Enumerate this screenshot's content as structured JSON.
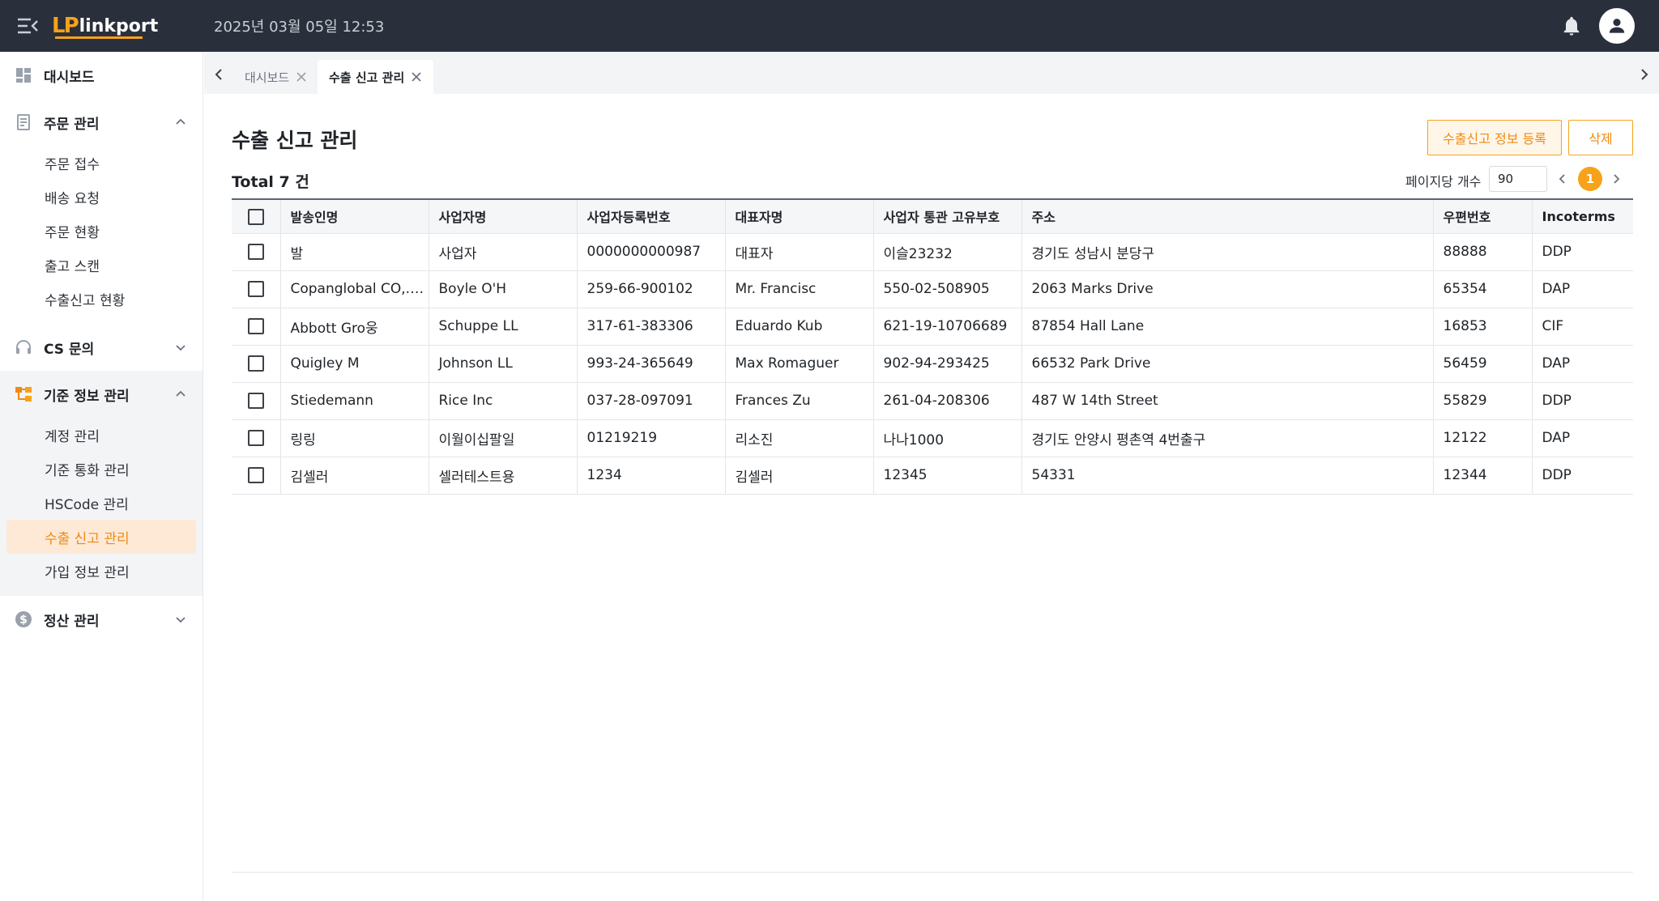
{
  "header": {
    "logo_mark": "LP",
    "logo_text": "linkport",
    "datetime": "2025년 03월 05일 12:53"
  },
  "sidebar": {
    "groups": [
      {
        "label": "대시보드",
        "icon": "dashboard-icon",
        "items": []
      },
      {
        "label": "주문 관리",
        "icon": "document-icon",
        "expanded": true,
        "items": [
          {
            "label": "주문 접수"
          },
          {
            "label": "배송 요청"
          },
          {
            "label": "주문 현황"
          },
          {
            "label": "출고 스캔"
          },
          {
            "label": "수출신고 현황"
          }
        ]
      },
      {
        "label": "CS 문의",
        "icon": "headset-icon",
        "expanded": false,
        "items": []
      },
      {
        "label": "기준 정보 관리",
        "icon": "hierarchy-icon",
        "expanded": true,
        "items": [
          {
            "label": "계정 관리"
          },
          {
            "label": "기준 통화 관리"
          },
          {
            "label": "HSCode 관리"
          },
          {
            "label": "수출 신고 관리",
            "active": true
          },
          {
            "label": "가입 정보 관리"
          }
        ]
      },
      {
        "label": "정산 관리",
        "icon": "dollar-icon",
        "expanded": false,
        "items": []
      }
    ]
  },
  "tabs": [
    {
      "label": "대시보드"
    },
    {
      "label": "수출 신고 관리",
      "active": true
    }
  ],
  "page": {
    "title": "수출 신고 관리",
    "register_button": "수출신고 정보 등록",
    "delete_button": "삭제",
    "total_label": "Total 7 건",
    "page_size_label": "페이지당 개수",
    "page_size_value": "90",
    "current_page": "1"
  },
  "table": {
    "columns": [
      "발송인명",
      "사업자명",
      "사업자등록번호",
      "대표자명",
      "사업자 통관 고유부호",
      "주소",
      "우편번호",
      "Incoterms"
    ],
    "rows": [
      [
        "발",
        "사업자",
        "0000000000987",
        "대표자",
        "이슬23232",
        "경기도 성남시 분당구",
        "88888",
        "DDP"
      ],
      [
        "Copanglobal CO,.L...",
        "Boyle O'H",
        "259-66-900102",
        "Mr. Francisc",
        "550-02-508905",
        "2063 Marks Drive",
        "65354",
        "DAP"
      ],
      [
        "Abbott Gro웅",
        "Schuppe LL",
        "317-61-383306",
        "Eduardo Kub",
        "621-19-10706689",
        "87854 Hall Lane",
        "16853",
        "CIF"
      ],
      [
        "Quigley M",
        "Johnson LL",
        "993-24-365649",
        "Max Romaguer",
        "902-94-293425",
        "66532 Park Drive",
        "56459",
        "DAP"
      ],
      [
        "Stiedemann",
        "Rice Inc",
        "037-28-097091",
        "Frances Zu",
        "261-04-208306",
        "487 W 14th Street",
        "55829",
        "DDP"
      ],
      [
        "링링",
        "이월이십팔일",
        "01219219",
        "리소진",
        "나나1000",
        "경기도 안양시 평촌역 4번출구",
        "12122",
        "DAP"
      ],
      [
        "김셀러",
        "셀러테스트용",
        "1234",
        "김셀러",
        "12345",
        "54331",
        "12344",
        "DDP"
      ]
    ]
  },
  "colors": {
    "topbar": "#2a303b",
    "accent": "#f7a21b",
    "active_bg": "#fde9d6"
  }
}
